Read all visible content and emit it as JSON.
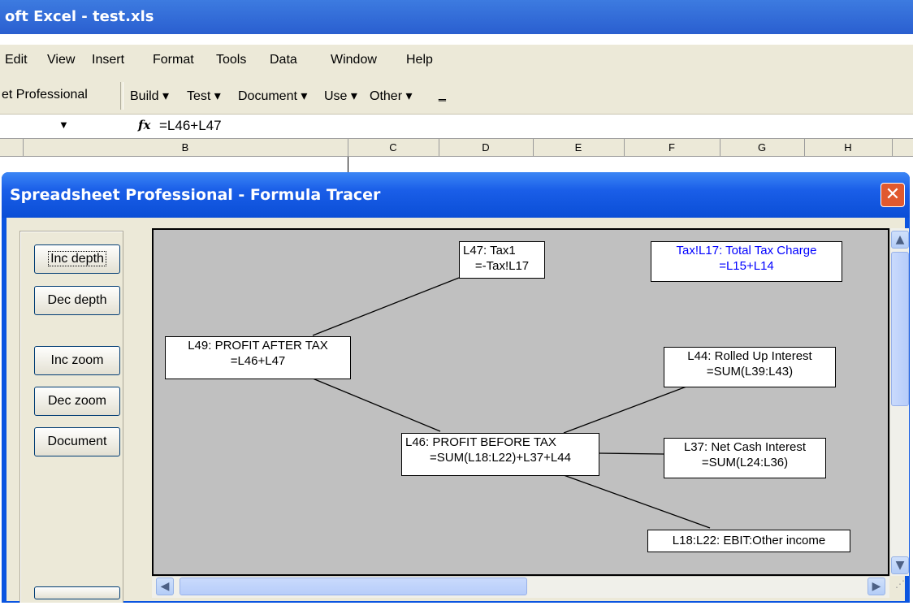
{
  "excel": {
    "title": "oft Excel - test.xls",
    "menu": [
      "Edit",
      "View",
      "Insert",
      "Format",
      "Tools",
      "Data",
      "Window",
      "Help"
    ],
    "toolbar": {
      "addin_label": "et Professional",
      "build": "Build ▾",
      "test": "Test ▾",
      "document": "Document ▾",
      "use": "Use ▾",
      "other": "Other ▾",
      "overflow": "‗"
    },
    "formula_bar": {
      "name_box_arrow": "▼",
      "fx": "fx",
      "formula": "=L46+L47"
    },
    "columns": [
      "B",
      "C",
      "D",
      "E",
      "F",
      "G",
      "H"
    ]
  },
  "dialog": {
    "title": "Spreadsheet Professional - Formula Tracer",
    "close": "✕",
    "buttons": {
      "inc_depth": "Inc depth",
      "dec_depth": "Dec depth",
      "inc_zoom": "Inc zoom",
      "dec_zoom": "Dec zoom",
      "document": "Document"
    },
    "nodes": {
      "l47": {
        "name": "L47: Tax1",
        "formula": "=-Tax!L17"
      },
      "tax_l17": {
        "name": "Tax!L17: Total Tax Charge",
        "formula": "=L15+L14"
      },
      "l49": {
        "name": "L49: PROFIT AFTER TAX",
        "formula": "=L46+L47"
      },
      "l44": {
        "name": "L44: Rolled Up Interest",
        "formula": "=SUM(L39:L43)"
      },
      "l46": {
        "name": "L46: PROFIT BEFORE TAX",
        "formula": "=SUM(L18:L22)+L37+L44"
      },
      "l37": {
        "name": "L37: Net Cash Interest",
        "formula": "=SUM(L24:L36)"
      },
      "l18": {
        "name": "L18:L22: EBIT:Other income"
      }
    },
    "colors": {
      "linked_sheet_node": "#0000ff",
      "canvas": "#c0c0c0",
      "titlebar": "#0a54e0"
    }
  }
}
